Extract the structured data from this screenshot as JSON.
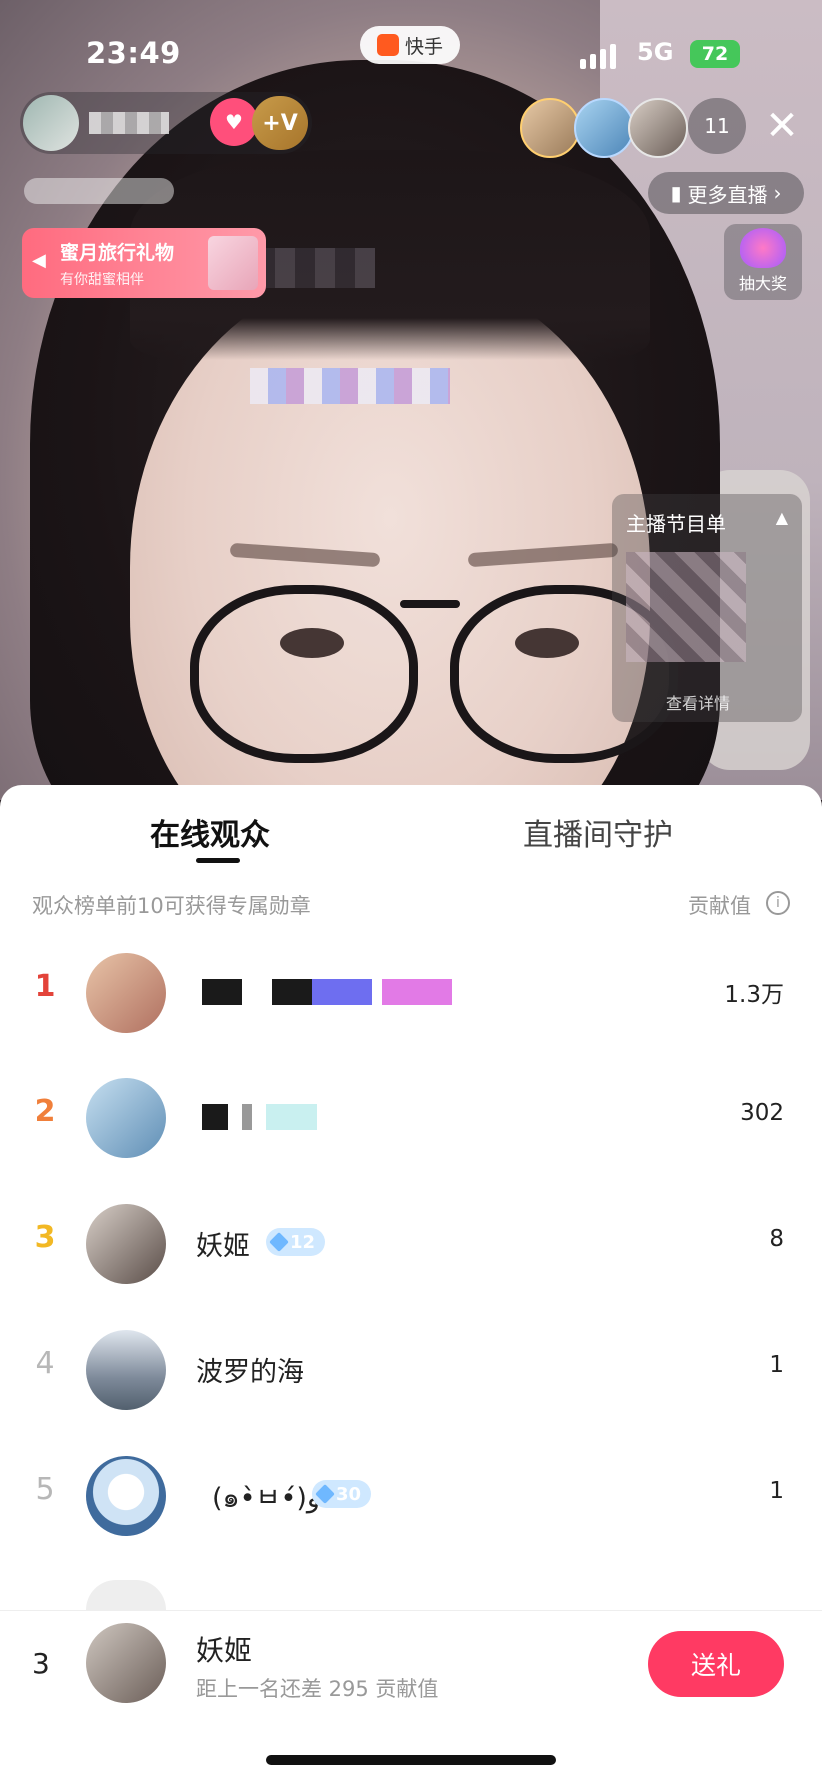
{
  "status_bar": {
    "time": "23:49",
    "network": "5G",
    "battery": "72"
  },
  "app": {
    "name": "快手"
  },
  "host": {
    "follow_icon": "heart-plus-icon",
    "vip_label": "+V"
  },
  "viewers": {
    "count": "11"
  },
  "top_actions": {
    "more_live": "更多直播"
  },
  "gift_banner": {
    "title": "蜜月旅行礼物",
    "subtitle": "有你甜蜜相伴"
  },
  "lottery": {
    "label": "抽大奖"
  },
  "program": {
    "title": "主播节目单",
    "detail": "查看详情"
  },
  "sheet": {
    "tabs": [
      {
        "label": "在线观众"
      },
      {
        "label": "直播间守护"
      }
    ],
    "subheader": "观众榜单前10可获得专属勋章",
    "contribution_label": "贡献值",
    "rows": [
      {
        "rank": "1",
        "name": "",
        "score": "1.3万"
      },
      {
        "rank": "2",
        "name": "",
        "score": "302"
      },
      {
        "rank": "3",
        "name": "妖姬",
        "level": "12",
        "score": "8"
      },
      {
        "rank": "4",
        "name": "波罗的海",
        "score": "1"
      },
      {
        "rank": "5",
        "name": "(๑•̀ㅂ•́)و✧",
        "level": "30",
        "score": "1"
      }
    ]
  },
  "footer": {
    "rank": "3",
    "name": "妖姬",
    "subtitle": "距上一名还差 295 贡献值",
    "send_label": "送礼"
  },
  "colors": {
    "rank1": "#e3433a",
    "rank2": "#f07f3a",
    "rank3": "#f2b824",
    "rank_other": "#b7b7b7",
    "accent": "#ff3a63"
  }
}
